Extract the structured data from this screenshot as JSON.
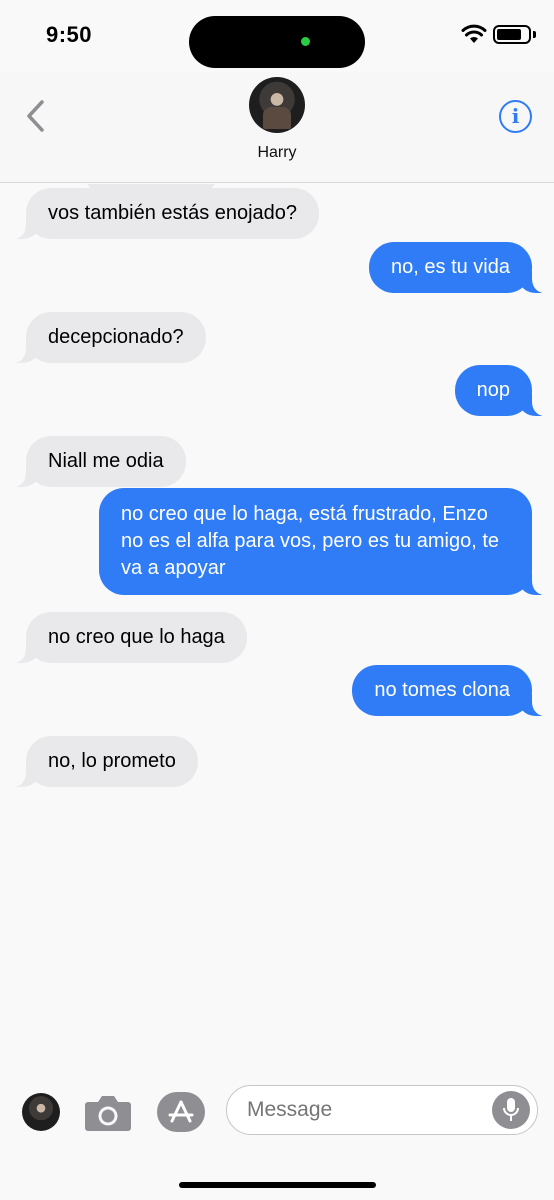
{
  "status_bar": {
    "time": "9:50"
  },
  "header": {
    "contact_name": "Harry"
  },
  "messages": [
    {
      "direction": "received",
      "text": "vos también estás enojado?"
    },
    {
      "direction": "sent",
      "text": "no, es tu vida"
    },
    {
      "direction": "received",
      "text": "decepcionado?"
    },
    {
      "direction": "sent",
      "text": "nop"
    },
    {
      "direction": "received",
      "text": "Niall me odia"
    },
    {
      "direction": "sent",
      "text": "no creo que lo haga, está frustrado, Enzo no es el alfa para vos, pero es tu amigo, te va a apoyar"
    },
    {
      "direction": "received",
      "text": "no creo que lo haga"
    },
    {
      "direction": "sent",
      "text": "no tomes clona"
    },
    {
      "direction": "received",
      "text": "no, lo prometo"
    }
  ],
  "composer": {
    "placeholder": "Message"
  },
  "colors": {
    "sent_bubble": "#2f7cf6",
    "received_bubble": "#e9e9eb",
    "accent": "#2f7cf6"
  },
  "icons": [
    "wifi-icon",
    "battery-icon",
    "back-chevron-icon",
    "info-icon",
    "camera-icon",
    "app-store-icon",
    "microphone-icon"
  ]
}
